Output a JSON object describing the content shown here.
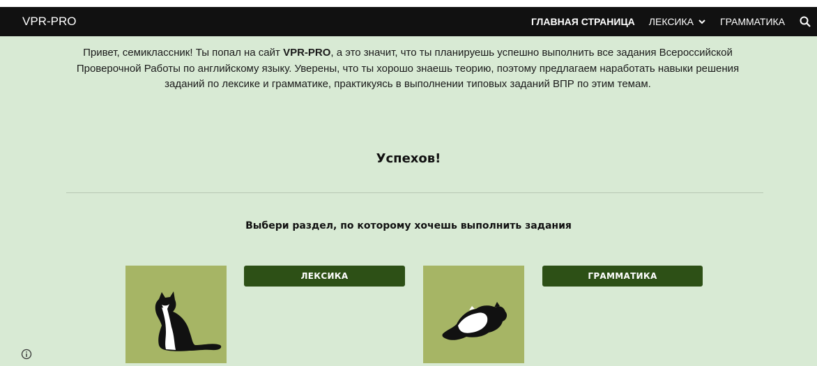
{
  "header": {
    "brand": "VPR-PRO",
    "nav": [
      {
        "label": "ГЛАВНАЯ СТРАНИЦА"
      },
      {
        "label": "ЛЕКСИКА"
      },
      {
        "label": "ГРАММАТИКА"
      }
    ]
  },
  "intro": {
    "part1": "Привет, семиклассник! Ты попал на сайт ",
    "brand": "VPR-PRO",
    "part2": ", а это значит, что ты планируешь успешно выполнить все задания Всероссийской Проверочной Работы по английскому языку.  Уверены, что ты хорошо знаешь теорию, поэтому предлагаем наработать навыки решения заданий по лексике и грамматике, практикуясь в выполнении типовых заданий ВПР по этим темам."
  },
  "success": "Успехов!",
  "choose": "Выбери раздел, по которому хочешь выполнить задания",
  "sections": [
    {
      "button": "ЛЕКСИКА"
    },
    {
      "button": "ГРАММАТИКА"
    }
  ],
  "colors": {
    "header_bg": "#111111",
    "page_bg": "#d8ead4",
    "tile_bg": "#a6b565",
    "button_bg": "#2d5016"
  }
}
